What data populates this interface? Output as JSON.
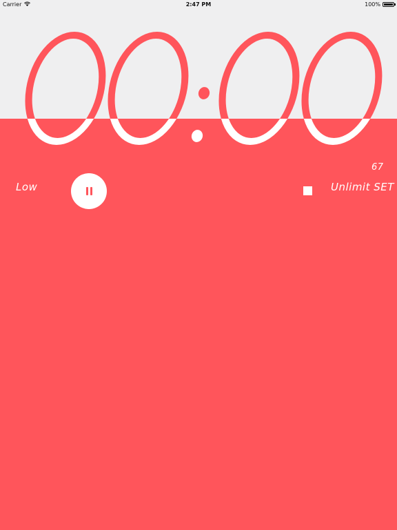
{
  "status_bar": {
    "carrier": "Carrier",
    "time": "2:47 PM",
    "battery": "100%"
  },
  "timer": {
    "display": "00:00",
    "digits": [
      "0",
      "0",
      "0",
      "0"
    ]
  },
  "controls": {
    "mode_label": "Low",
    "set_label": "Unlimit SET",
    "count": "67"
  },
  "colors": {
    "accent": "#ff555b",
    "top_background": "#efeff0",
    "foreground": "#ffffff"
  },
  "icons": {
    "pause": "pause-icon",
    "stop": "stop-icon",
    "wifi": "wifi-icon",
    "battery": "battery-icon"
  }
}
